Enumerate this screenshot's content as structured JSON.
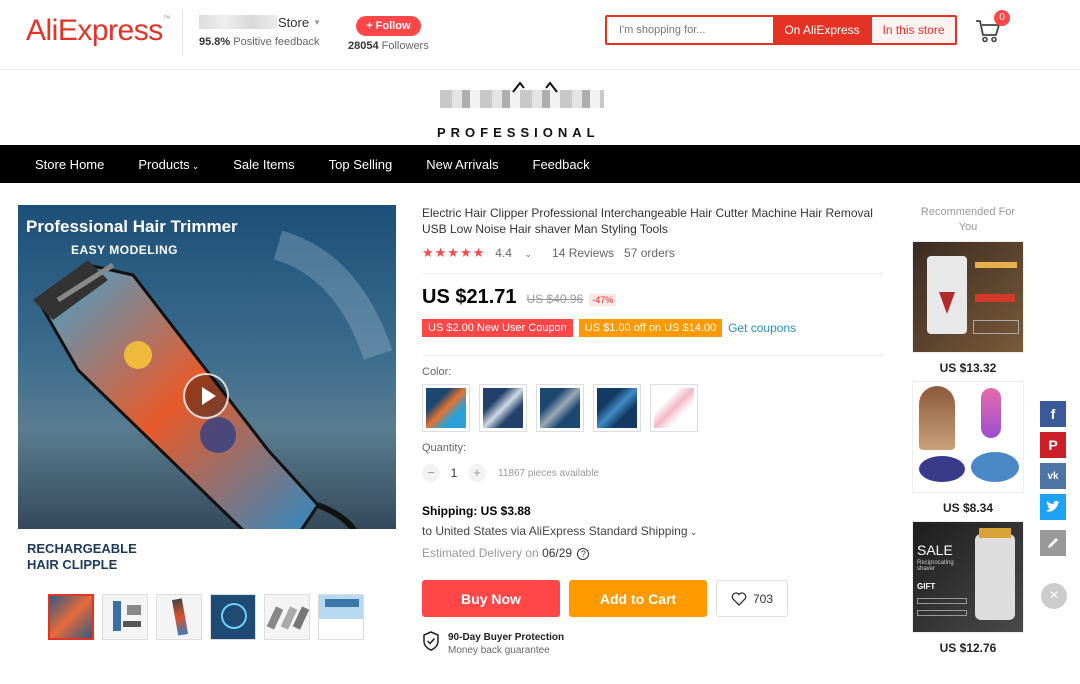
{
  "header": {
    "logo": "AliExpress",
    "store_name_suffix": "Store",
    "feedback_percent": "95.8%",
    "feedback_label": "Positive feedback",
    "follow_label": "+ Follow",
    "followers_count": "28054",
    "followers_label": "Followers",
    "search_placeholder": "I'm shopping for...",
    "search_on_label": "On AliExpress",
    "search_store_label": "In this store",
    "cart_count": "0"
  },
  "banner": {
    "tagline": "PROFESSIONAL"
  },
  "nav": {
    "items": [
      "Store Home",
      "Products",
      "Sale Items",
      "Top Selling",
      "New Arrivals",
      "Feedback"
    ]
  },
  "gallery": {
    "image_title": "Professional Hair Trimmer",
    "image_subtitle": "EASY MODELING",
    "image_bottom_line1": "RECHARGEABLE",
    "image_bottom_line2": "HAIR CLIPPLE"
  },
  "product": {
    "title": "Electric Hair Clipper Professional Interchangeable Hair Cutter Machine Hair Removal USB Low Noise Hair shaver Man Styling Tools",
    "rating": "4.4",
    "reviews": "14 Reviews",
    "orders": "57 orders",
    "price": "US $21.71",
    "old_price": "US $40.96",
    "discount": "-47%",
    "coupon1": "US $2.00 New User Coupon",
    "coupon2": "US $1.00 off on US $14.00",
    "get_coupons": "Get coupons",
    "color_label": "Color:",
    "quantity_label": "Quantity:",
    "quantity_value": "1",
    "available": "11867 pieces available",
    "shipping_title": "Shipping: US $3.88",
    "shipping_line": "to United States via AliExpress Standard Shipping",
    "delivery_label": "Estimated Delivery on",
    "delivery_date": "06/29",
    "buy_now": "Buy Now",
    "add_to_cart": "Add to Cart",
    "wishlist_count": "703",
    "protection_title": "90-Day Buyer Protection",
    "protection_sub": "Money back guarantee"
  },
  "recommended": {
    "title": "Recommended For You",
    "items": [
      {
        "price": "US $13.32"
      },
      {
        "price": "US $8.34"
      },
      {
        "price": "US $12.76",
        "badge": "SALE",
        "badge_sub": "Reciprocating shaver",
        "badge_gift": "GIFT"
      }
    ]
  },
  "colors": {
    "accent": "#e43225",
    "buy": "#ff4747",
    "cart": "#ff9900",
    "link": "#2a8fbd"
  }
}
